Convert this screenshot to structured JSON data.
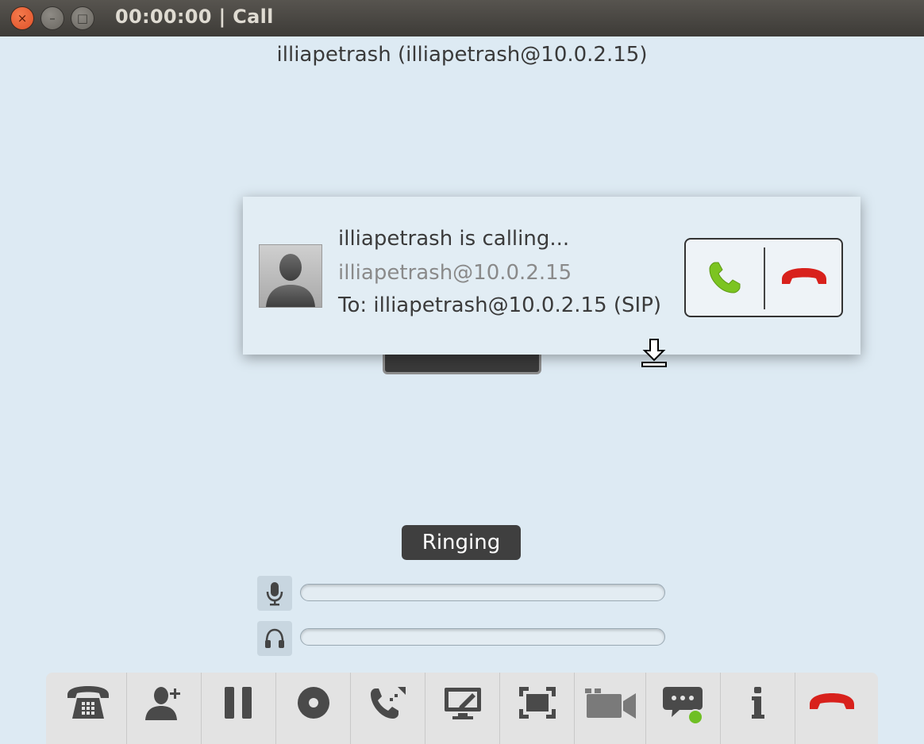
{
  "window": {
    "title": "00:00:00 | Call",
    "close_glyph": "×",
    "minimize_glyph": "–",
    "maximize_glyph": "□"
  },
  "call": {
    "peer_title": "illiapetrash (illiapetrash@10.0.2.15)",
    "state": "Ringing"
  },
  "incoming_popup": {
    "heading": "illiapetrash is calling...",
    "caller_address": "illiapetrash@10.0.2.15",
    "to_line": "To: illiapetrash@10.0.2.15 (SIP)",
    "answer_icon": "phone-answer-icon",
    "decline_icon": "phone-hangup-icon"
  },
  "audio_levels": {
    "microphone": {
      "icon": "microphone-icon",
      "level": 0
    },
    "speaker": {
      "icon": "headphones-icon",
      "level": 0
    }
  },
  "toolbar": {
    "buttons": [
      {
        "name": "dialpad",
        "icon": "dialpad-phone-icon"
      },
      {
        "name": "add-participant",
        "icon": "add-user-icon"
      },
      {
        "name": "hold",
        "icon": "pause-icon"
      },
      {
        "name": "record",
        "icon": "record-icon"
      },
      {
        "name": "transfer",
        "icon": "call-transfer-icon"
      },
      {
        "name": "share-desktop",
        "icon": "desktop-share-icon"
      },
      {
        "name": "fullscreen",
        "icon": "fullscreen-icon"
      },
      {
        "name": "video",
        "icon": "video-camera-icon"
      },
      {
        "name": "chat",
        "icon": "chat-icon"
      },
      {
        "name": "info",
        "icon": "info-icon"
      },
      {
        "name": "hangup",
        "icon": "phone-hangup-icon"
      }
    ]
  },
  "colors": {
    "background": "#ddeaf3",
    "answer_green": "#7cc421",
    "hangup_red": "#d8211c",
    "presence_green": "#6fbf24"
  }
}
